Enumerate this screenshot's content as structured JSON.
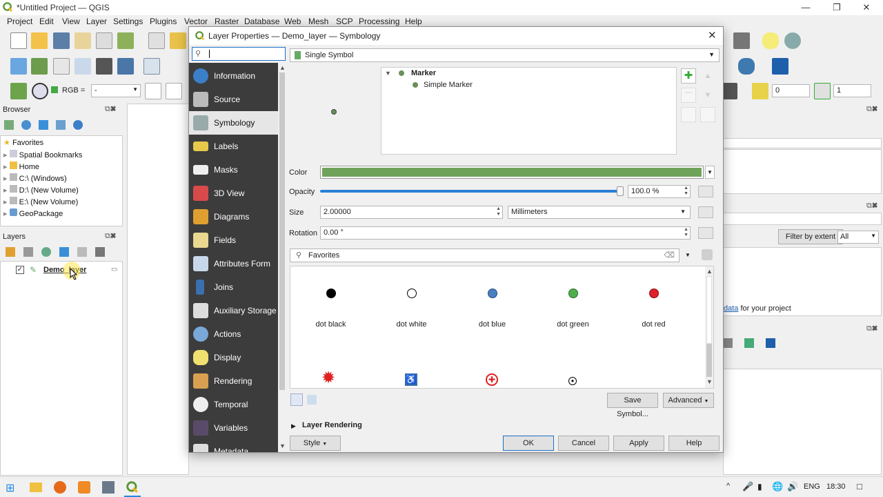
{
  "window": {
    "title": "*Untitled Project — QGIS"
  },
  "menu": [
    "Project",
    "Edit",
    "View",
    "Layer",
    "Settings",
    "Plugins",
    "Vector",
    "Raster",
    "Database",
    "Web",
    "Mesh",
    "SCP",
    "Processing",
    "Help"
  ],
  "toolbar": {
    "rgb_label": "RGB =",
    "rgb_value": "-",
    "spin1": "0",
    "spin2": "1"
  },
  "browser": {
    "title": "Browser",
    "items": [
      "Favorites",
      "Spatial Bookmarks",
      "Home",
      "C:\\ (Windows)",
      "D:\\ (New Volume)",
      "E:\\ (New Volume)",
      "GeoPackage"
    ]
  },
  "layers": {
    "title": "Layers",
    "item": "Demo_layer"
  },
  "right_panel": {
    "filter_label": "Filter by extent",
    "filter_value": "All",
    "metadata_link": "data",
    "metadata_text": " for your project"
  },
  "dialog": {
    "title": "Layer Properties — Demo_layer — Symbology",
    "search_placeholder": "",
    "renderer": "Single Symbol",
    "sidebar": [
      "Information",
      "Source",
      "Symbology",
      "Labels",
      "Masks",
      "3D View",
      "Diagrams",
      "Fields",
      "Attributes Form",
      "Joins",
      "Auxiliary Storage",
      "Actions",
      "Display",
      "Rendering",
      "Temporal",
      "Variables",
      "Metadata"
    ],
    "tree": {
      "root": "Marker",
      "child": "Simple Marker"
    },
    "color_label": "Color",
    "color_hex": "#6fa35a",
    "opacity_label": "Opacity",
    "opacity_value": "100.0 %",
    "opacity_fraction": 1.0,
    "size_label": "Size",
    "size_value": "2.00000",
    "size_unit": "Millimeters",
    "rotation_label": "Rotation",
    "rotation_value": "0.00 °",
    "symbol_search": "Favorites",
    "symbols": [
      {
        "name": "dot  black",
        "color": "#000000"
      },
      {
        "name": "dot  white",
        "color": "#ffffff"
      },
      {
        "name": "dot blue",
        "color": "#4a7fc0"
      },
      {
        "name": "dot green",
        "color": "#4fae4a"
      },
      {
        "name": "dot red",
        "color": "#e0202a"
      }
    ],
    "save_symbol": "Save Symbol...",
    "advanced": "Advanced",
    "layer_rendering": "Layer Rendering",
    "style": "Style",
    "ok": "OK",
    "cancel": "Cancel",
    "apply": "Apply",
    "help": "Help"
  },
  "taskbar": {
    "lang": "ENG",
    "time": "18:30"
  }
}
